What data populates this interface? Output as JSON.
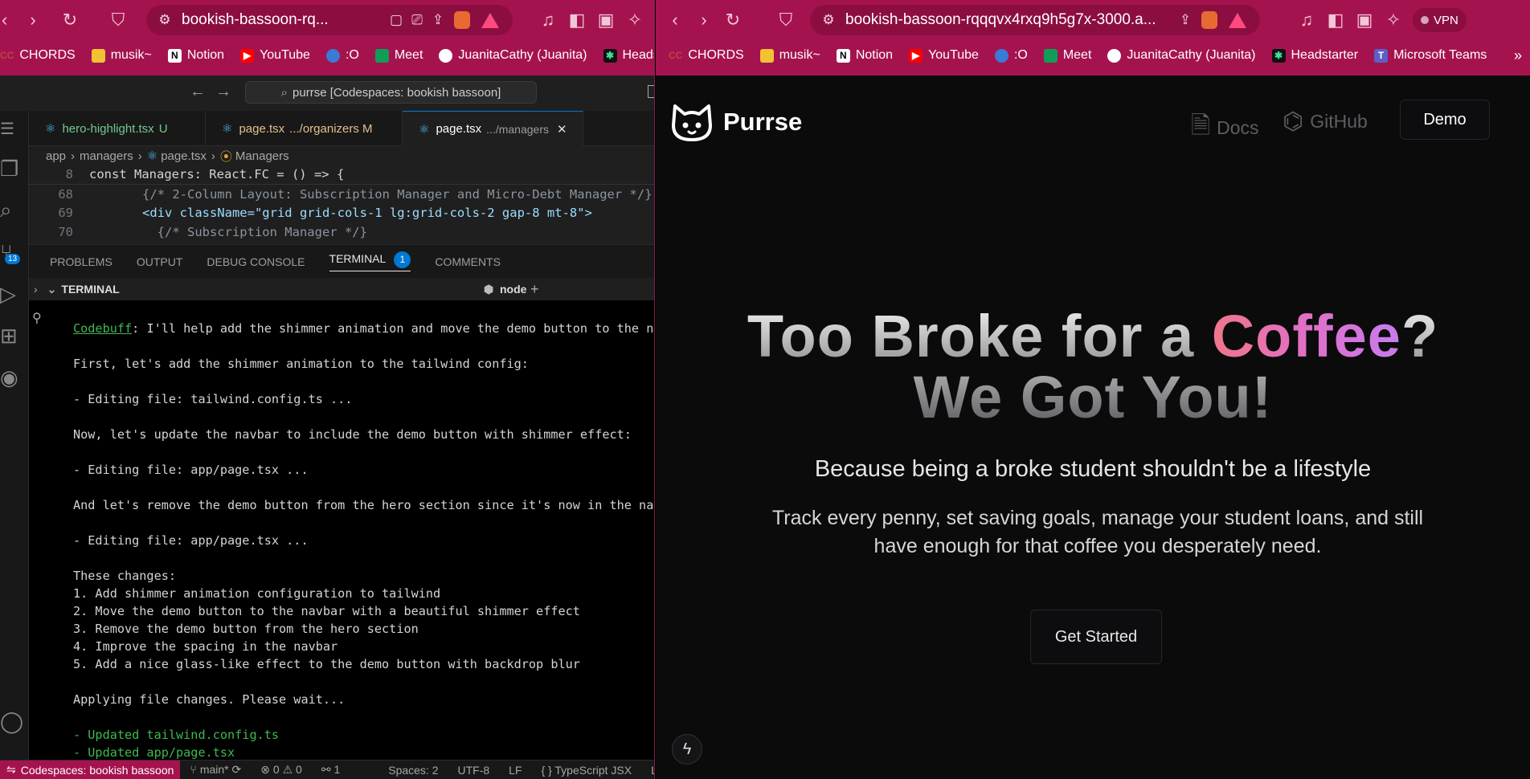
{
  "left_browser": {
    "url": "bookish-bassoon-rq...",
    "bookmarks": [
      "CHORDS",
      "musik~",
      "Notion",
      "YouTube",
      ":O",
      "Meet",
      "JuanitaCathy (Juanita)",
      "Headsta"
    ]
  },
  "right_browser": {
    "url": "bookish-bassoon-rqqqvx4rxq9h5g7x-3000.a...",
    "vpn_label": "VPN",
    "bookmarks": [
      "CHORDS",
      "musik~",
      "Notion",
      "YouTube",
      ":O",
      "Meet",
      "JuanitaCathy (Juanita)",
      "Headstarter",
      "Microsoft Teams"
    ]
  },
  "vscode": {
    "command_center": "purrse [Codespaces: bookish bassoon]",
    "source_control_badge": "13",
    "tabs": [
      {
        "name": "hero-highlight.tsx",
        "suffix": "U",
        "color": "#73c991",
        "suffix_color": "#73c991"
      },
      {
        "name": "page.tsx",
        "suffix": ".../organizers  M",
        "color": "#e2c08d",
        "suffix_color": "#e2c08d"
      },
      {
        "name": "page.tsx",
        "suffix": ".../managers",
        "color": "#ffffff",
        "suffix_color": "#9d9d9d"
      }
    ],
    "breadcrumb": [
      "app",
      "managers",
      "page.tsx",
      "Managers"
    ],
    "code_lines": [
      {
        "num": "8",
        "text": "const Managers: React.FC = () => {"
      },
      {
        "num": "68",
        "text": "      {/* 2-Column Layout: Subscription Manager and Micro-Debt Manager */}"
      },
      {
        "num": "69",
        "text": "      <div className=\"grid grid-cols-1 lg:grid-cols-2 gap-8 mt-8\">"
      },
      {
        "num": "70",
        "text": "        {/* Subscription Manager */}"
      }
    ],
    "panel_tabs": [
      "PROBLEMS",
      "OUTPUT",
      "DEBUG CONSOLE",
      "TERMINAL",
      "COMMENTS"
    ],
    "terminal_badge": "1",
    "terminal_header": "TERMINAL",
    "terminal_process": "node",
    "terminal_agent": "Codebuff",
    "terminal_lines": [
      ": I'll help add the shimmer animation and move the demo button to the navbar",
      "First, let's add the shimmer animation to the tailwind config:",
      "- Editing file: tailwind.config.ts ...",
      "Now, let's update the navbar to include the demo button with shimmer effect:",
      "- Editing file: app/page.tsx ...",
      "And let's remove the demo button from the hero section since it's now in the navbar",
      "- Editing file: app/page.tsx ...",
      "These changes:",
      "1. Add shimmer animation configuration to tailwind",
      "2. Move the demo button to the navbar with a beautiful shimmer effect",
      "3. Remove the demo button from the hero section",
      "4. Improve the spacing in the navbar",
      "5. Add a nice glass-like effect to the demo button with backdrop blur",
      "Applying file changes. Please wait...",
      "- Updated tailwind.config.ts",
      "- Updated app/page.tsx"
    ],
    "status": {
      "remote": "Codespaces: bookish bassoon",
      "branch": "main*",
      "errors": "0",
      "warnings": "0",
      "ports": "1",
      "spaces": "Spaces: 2",
      "encoding": "UTF-8",
      "eol": "LF",
      "language": "TypeScript JSX",
      "trailing": "La"
    }
  },
  "site": {
    "brand": "Purrse",
    "nav": {
      "docs": "Docs",
      "github": "GitHub",
      "demo": "Demo"
    },
    "hero": {
      "line1_a": "Too Broke for a ",
      "line1_highlight": "Coffee",
      "line1_b": "?",
      "line2": "We Got You!"
    },
    "subtitle": "Because being a broke student shouldn't be a lifestyle",
    "description": "Track every penny, set saving goals, manage your student loans, and still have enough for that coffee you desperately need.",
    "cta": "Get Started"
  },
  "colors": {
    "browser_chrome": "#a5134f",
    "omnibox": "#8c0e41",
    "terminal_green": "#3fb950",
    "coffee_gradient_start": "#f0768a",
    "coffee_gradient_end": "#c77cf0"
  }
}
